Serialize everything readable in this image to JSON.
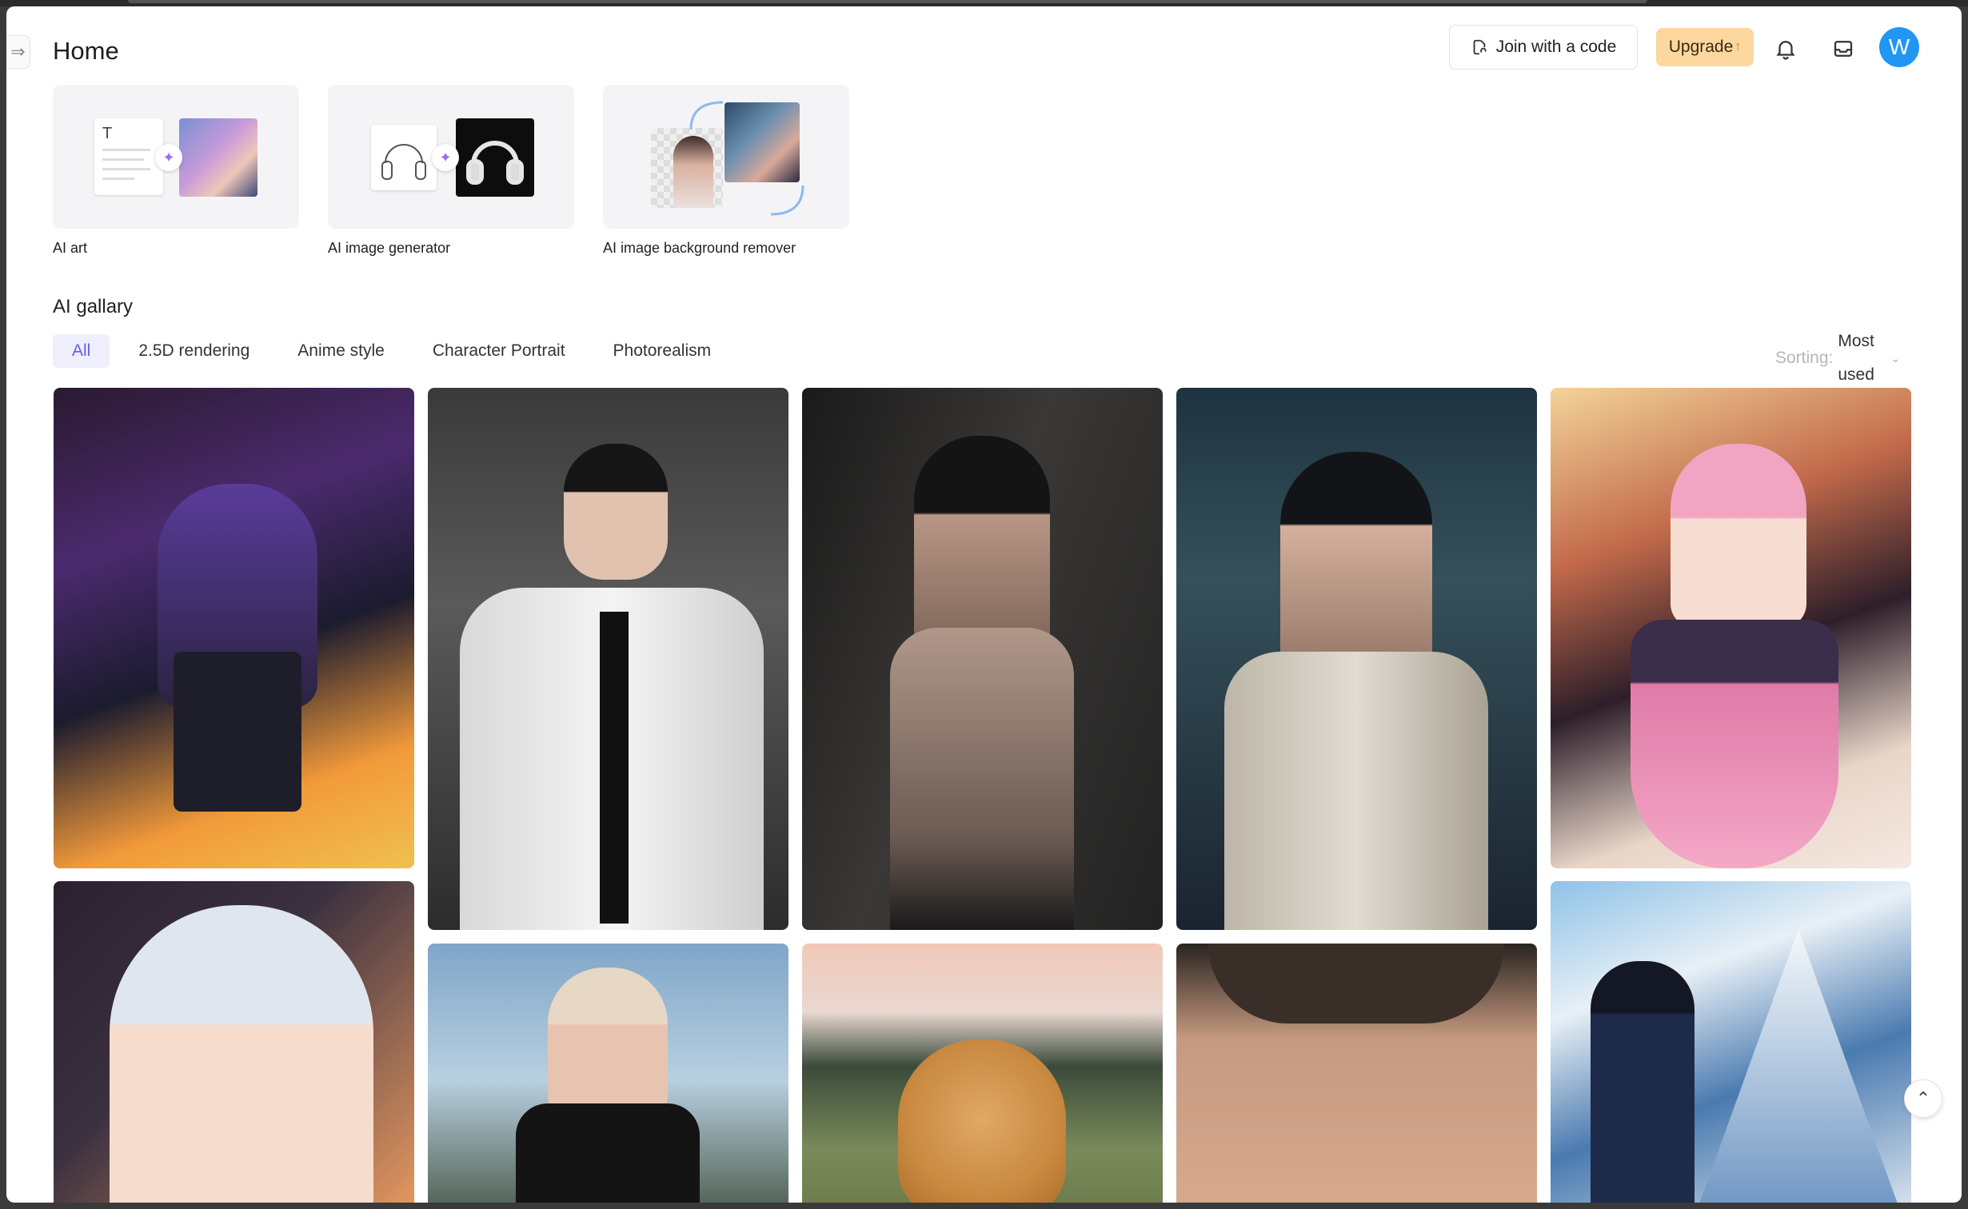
{
  "header": {
    "title": "Home",
    "join_label": "Join with a code",
    "upgrade_label": "Upgrade",
    "avatar_initial": "W"
  },
  "tools": [
    {
      "label": "AI art",
      "icon": "text-to-art"
    },
    {
      "label": "AI image generator",
      "icon": "headphone-sketch-to-render"
    },
    {
      "label": "AI image background remover",
      "icon": "portrait-cutout"
    }
  ],
  "gallery": {
    "title": "AI gallary",
    "filters": [
      "All",
      "2.5D rendering",
      "Anime style",
      "Character Portrait",
      "Photorealism"
    ],
    "active_filter": "All",
    "sorting_label": "Sorting:",
    "sorting_value": "Most used",
    "items": [
      {
        "subject": "anime girl singing with microphone"
      },
      {
        "subject": "young man in white shirt and black tie"
      },
      {
        "subject": "woman portrait in shadow"
      },
      {
        "subject": "woman in beige coat, city bokeh"
      },
      {
        "subject": "anime princess with crown"
      },
      {
        "subject": "anime girl with silver hair"
      },
      {
        "subject": "blonde woman in black top"
      },
      {
        "subject": "golden retriever at sunset"
      },
      {
        "subject": "man close-up face"
      },
      {
        "subject": "anime traveler facing mountains"
      }
    ]
  },
  "colors": {
    "accent": "#6b5ce7",
    "avatar": "#2196f3",
    "upgrade": "#fcd79e"
  }
}
